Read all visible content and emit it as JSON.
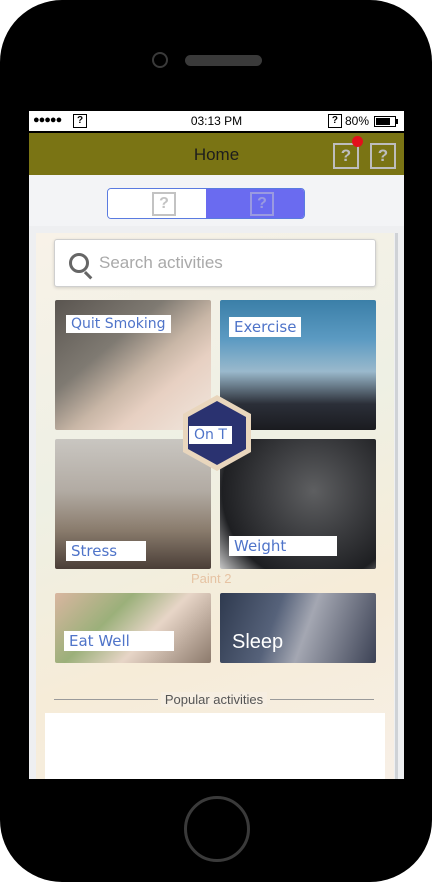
{
  "status_bar": {
    "signal": "●●●●●",
    "time": "03:13 PM",
    "battery": "80%",
    "unknown_glyph": "?"
  },
  "nav_bar": {
    "title": "Home",
    "right_icon_1": "?",
    "right_icon_2": "?",
    "notification_dot_color": "#e3101b",
    "background_color": "#7a7414"
  },
  "segmented_control": {
    "left_icon": "?",
    "right_icon": "?",
    "selected": "right",
    "selected_color": "#6a6bf0"
  },
  "search": {
    "placeholder": "Search activities",
    "icon": "search-icon"
  },
  "activities": [
    {
      "id": "quit-smoking",
      "label": "Quit Smoking"
    },
    {
      "id": "exercise",
      "label": "Exercise"
    },
    {
      "id": "stress",
      "label": "Stress"
    },
    {
      "id": "weight",
      "label": "Weight"
    },
    {
      "id": "eat-well",
      "label": "Eat Well"
    },
    {
      "id": "sleep",
      "label": "Sleep"
    }
  ],
  "center_badge": {
    "label": "On T",
    "color": "#2a3270"
  },
  "watermark_text": "Paint 2",
  "popular_section": {
    "title": "Popular activities"
  }
}
